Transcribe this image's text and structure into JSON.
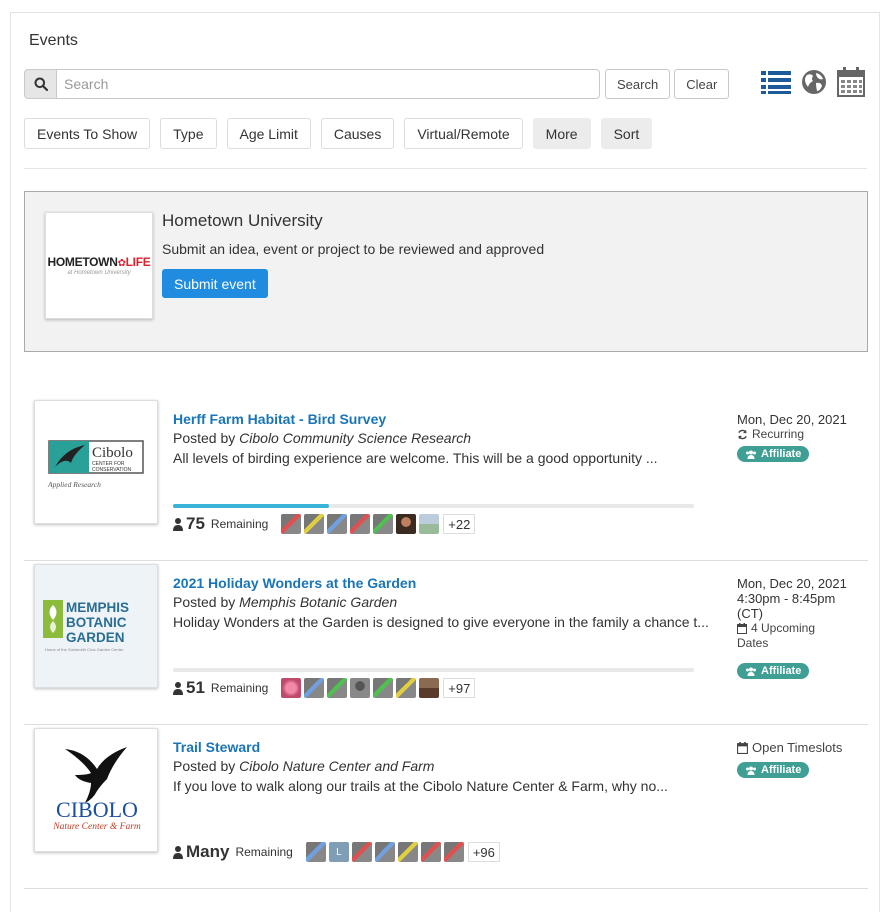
{
  "page": {
    "title": "Events"
  },
  "search": {
    "placeholder": "Search",
    "value": "",
    "search_label": "Search",
    "clear_label": "Clear"
  },
  "view_icons": [
    "list-view-icon",
    "globe-icon",
    "calendar-icon"
  ],
  "filters": [
    "Events To Show",
    "Type",
    "Age Limit",
    "Causes",
    "Virtual/Remote",
    "More",
    "Sort"
  ],
  "promo": {
    "logo_main": "HOMETOWN",
    "logo_accent": "LIFE",
    "logo_sub": "at Hometown University",
    "name": "Hometown University",
    "description": "Submit an idea, event or project to be reviewed and approved",
    "button_label": "Submit event"
  },
  "events": [
    {
      "title": "Herff Farm Habitat - Bird Survey",
      "posted_prefix": "Posted by ",
      "posted_by": "Cibolo Community Science Research",
      "description": "All levels of birding experience are welcome.  This will be a good opportunity ...",
      "progress": 0.3,
      "remaining_count": "75",
      "remaining_label": "Remaining",
      "more_count": "+22",
      "date": "Mon, Dec 20, 2021",
      "time": "",
      "extra": "Recurring",
      "badge": "Affiliate",
      "logo": {
        "line1": "Cibolo",
        "line2": "CENTER FOR",
        "line3": "CONSERVATION",
        "caption": "Applied Research"
      }
    },
    {
      "title": "2021 Holiday Wonders at the Garden",
      "posted_prefix": "Posted by ",
      "posted_by": "Memphis Botanic Garden",
      "description": "Holiday Wonders at the Garden is designed to give everyone in the family a chance t...",
      "progress": 0,
      "remaining_count": "51",
      "remaining_label": "Remaining",
      "more_count": "+97",
      "date": "Mon, Dec 20, 2021",
      "time": "4:30pm - 8:45pm",
      "time_zone": "(CT)",
      "extra_count": "4 Upcoming",
      "extra_label": "Dates",
      "badge": "Affiliate",
      "logo": {
        "line1": "MEMPHIS",
        "line2": "BOTANIC",
        "line3": "GARDEN",
        "caption": "Home of the Goldsmith Civic Garden Center"
      }
    },
    {
      "title": "Trail Steward",
      "posted_prefix": "Posted by ",
      "posted_by": "Cibolo Nature Center and Farm",
      "description": "If you love to walk along our trails at the Cibolo Nature Center & Farm, why no...",
      "remaining_count": "Many",
      "remaining_label": "Remaining",
      "more_count": "+96",
      "date": "Open Timeslots",
      "badge": "Affiliate",
      "logo": {
        "line1": "CIBOLO",
        "line2": "Nature Center & Farm"
      }
    }
  ],
  "colors": {
    "link": "#1a75b8",
    "accent_button": "#1f8ce0",
    "badge": "#3f9f94",
    "progress": "#39b3d7",
    "icon_blue": "#1c5a9a"
  }
}
